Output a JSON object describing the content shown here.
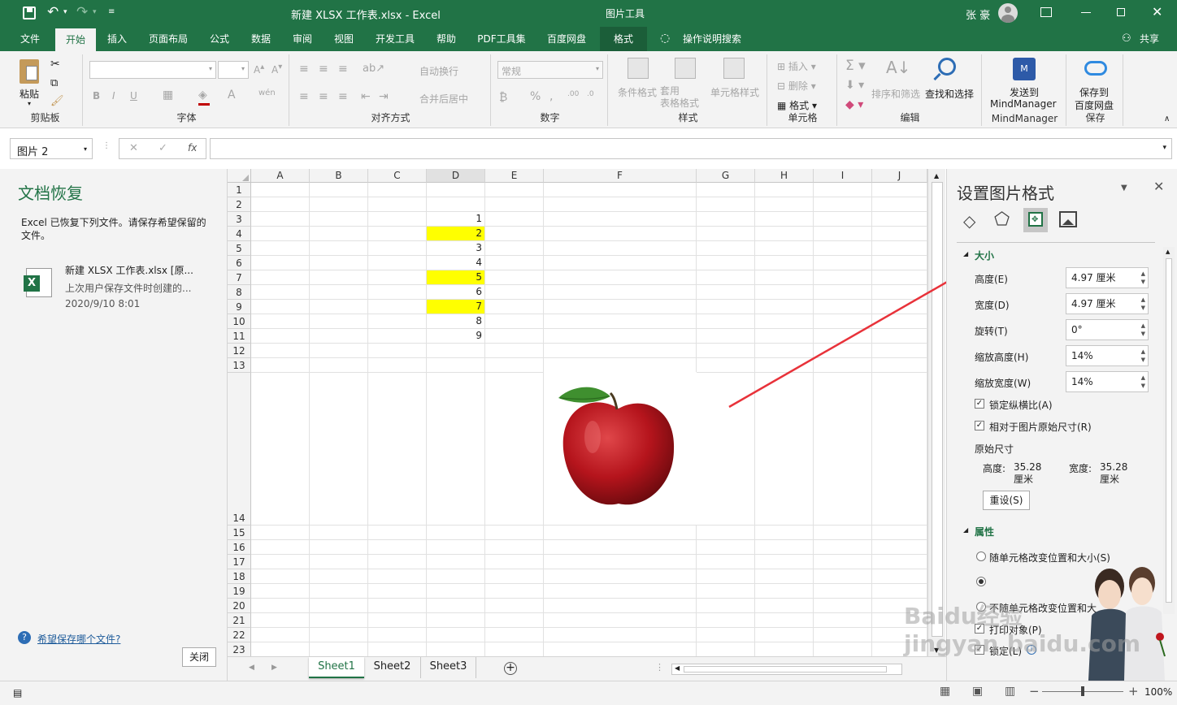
{
  "window": {
    "title": "新建 XLSX 工作表.xlsx  -  Excel",
    "context_tool": "图片工具",
    "user": "张 豪"
  },
  "tabs": [
    "文件",
    "开始",
    "插入",
    "页面布局",
    "公式",
    "数据",
    "审阅",
    "视图",
    "开发工具",
    "帮助",
    "PDF工具集",
    "百度网盘",
    "格式"
  ],
  "search_tab": "操作说明搜索",
  "share": "共享",
  "ribbon": {
    "clipboard": {
      "paste": "粘贴",
      "label": "剪贴板"
    },
    "font": {
      "label": "字体",
      "bold": "B",
      "italic": "I",
      "underline": "U"
    },
    "align": {
      "wrap": "自动换行",
      "merge": "合并后居中",
      "label": "对齐方式"
    },
    "number": {
      "format": "常规",
      "percent": "%",
      "label": "数字"
    },
    "styles": {
      "cond": "条件格式",
      "table": "套用\n表格格式",
      "cell": "单元格样式",
      "label": "样式"
    },
    "cells": {
      "insert": "插入",
      "delete": "删除",
      "format": "格式",
      "label": "单元格"
    },
    "edit": {
      "sort": "排序和筛选",
      "find": "查找和选择",
      "label": "编辑"
    },
    "mindmanager": {
      "send_line1": "发送到",
      "send_line2": "MindManager",
      "label": "MindManager"
    },
    "save": {
      "save_line1": "保存到",
      "save_line2": "百度网盘",
      "label": "保存"
    }
  },
  "formula_bar": {
    "name_box": "图片 2",
    "fx": "fx",
    "cancel": "✕",
    "enter": "✓"
  },
  "recovery": {
    "title": "文档恢复",
    "message": "Excel 已恢复下列文件。请保存希望保留的文件。",
    "file_name": "新建 XLSX 工作表.xlsx  [原...",
    "file_desc": "上次用户保存文件时创建的...",
    "file_date": "2020/9/10 8:01",
    "help_link": "希望保存哪个文件?",
    "close": "关闭"
  },
  "grid": {
    "columns": [
      "A",
      "B",
      "C",
      "D",
      "E",
      "F",
      "G",
      "H",
      "I",
      "J"
    ],
    "rows": [
      "1",
      "2",
      "3",
      "4",
      "5",
      "6",
      "7",
      "8",
      "9",
      "10",
      "11",
      "12",
      "13",
      "14",
      "15",
      "16",
      "17",
      "18",
      "19",
      "20",
      "21",
      "22",
      "23"
    ],
    "d_values": [
      "",
      "",
      "1",
      "2",
      "3",
      "4",
      "5",
      "6",
      "7",
      "8",
      "9",
      "",
      ""
    ],
    "highlight_color": "#ffff00"
  },
  "pane": {
    "title": "设置图片格式",
    "section_size": "大小",
    "height_label": "高度(E)",
    "height_value": "4.97 厘米",
    "width_label": "宽度(D)",
    "width_value": "4.97 厘米",
    "rotate_label": "旋转(T)",
    "rotate_value": "0°",
    "scale_h_label": "缩放高度(H)",
    "scale_h_value": "14%",
    "scale_w_label": "缩放宽度(W)",
    "scale_w_value": "14%",
    "lock_ratio": "锁定纵横比(A)",
    "relative": "相对于图片原始尺寸(R)",
    "orig_size": "原始尺寸",
    "orig_h_label": "高度:",
    "orig_h_value": "35.28 厘米",
    "orig_w_label": "宽度:",
    "orig_w_value": "35.28 厘米",
    "reset": "重设(S)",
    "section_props": "属性",
    "opt1": "随单元格改变位置和大小(S)",
    "opt3": "不随单元格改变位置和大",
    "print": "打印对象(P)",
    "locked": "锁定(L)"
  },
  "sheets": [
    "Sheet1",
    "Sheet2",
    "Sheet3"
  ],
  "zoom": "100%",
  "watermark": "Baidu经验 jingyan.baidu.com"
}
